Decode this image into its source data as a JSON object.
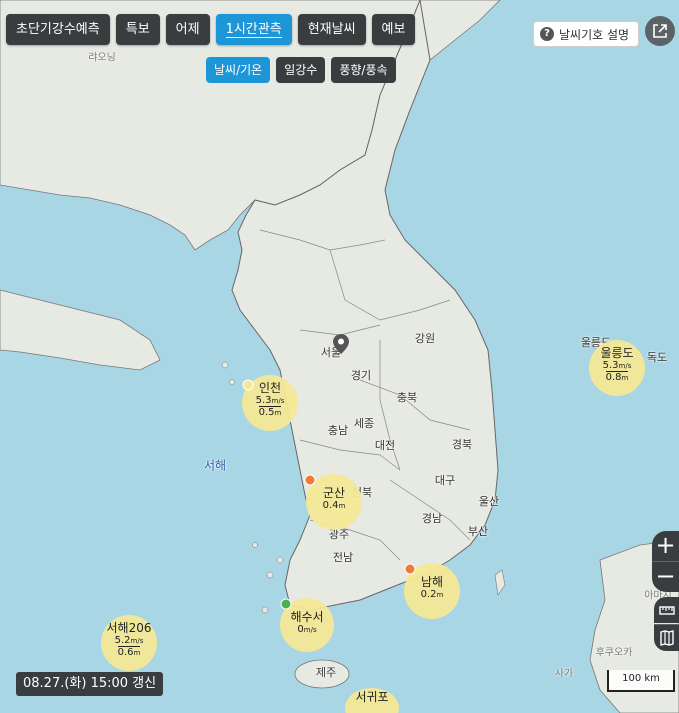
{
  "tabs": [
    "초단기강수예측",
    "특보",
    "어제",
    "1시간관측",
    "현재날씨",
    "예보"
  ],
  "active_tab": "1시간관측",
  "subtabs": [
    "날씨/기온",
    "일강수",
    "풍향/풍속"
  ],
  "active_subtab": "날씨/기온",
  "help_label": "날씨기호 설명",
  "timestamp": "08.27.(화) 15:00 갱신",
  "scale_label": "100 km",
  "places": {
    "laoning": "랴오닝",
    "gangwon": "강원",
    "gyeonggi": "경기",
    "chungbuk": "충북",
    "chungnam": "충남",
    "sejong": "세종",
    "daejeon": "대전",
    "gyeongbuk": "경북",
    "daegu": "대구",
    "ulsan": "울산",
    "busan": "부산",
    "gyeongnam": "경남",
    "jeonbuk": "전북",
    "gwangju": "광주",
    "jeonnam": "전남",
    "jeju": "제주",
    "seoul": "서울",
    "incheon_city": "인천",
    "ulleungdo": "울릉도",
    "dokdo": "독도",
    "yellow_sea": "서해",
    "fukuoka": "후쿠오카",
    "saga": "사가",
    "amami": "아마시"
  },
  "stations": [
    {
      "name": "인천",
      "wind": "5.3",
      "wind_unit": "m/s",
      "wave": "0.5",
      "wave_unit": "m"
    },
    {
      "name": "군산",
      "wind": "",
      "wind_unit": "",
      "wave": "0.4",
      "wave_unit": "m"
    },
    {
      "name": "울릉도",
      "wind": "5.3",
      "wind_unit": "m/s",
      "wave": "0.8",
      "wave_unit": "m"
    },
    {
      "name": "남해",
      "wind": "",
      "wind_unit": "",
      "wave": "0.2",
      "wave_unit": "m"
    },
    {
      "name": "해수서",
      "wind": "",
      "wind_unit": "",
      "wave": "0",
      "wave_unit": "m/s"
    },
    {
      "name": "서해206",
      "wind": "5.2",
      "wind_unit": "m/s",
      "wave": "0.6",
      "wave_unit": "m"
    },
    {
      "name": "서귀포",
      "wind": "",
      "wind_unit": "",
      "wave": "",
      "wave_unit": ""
    }
  ],
  "colors": {
    "active": "#1d96d8",
    "button": "#3a3d40",
    "sea": "#a9d6e5",
    "land": "#e7e9e3",
    "station": "#f4e896"
  }
}
